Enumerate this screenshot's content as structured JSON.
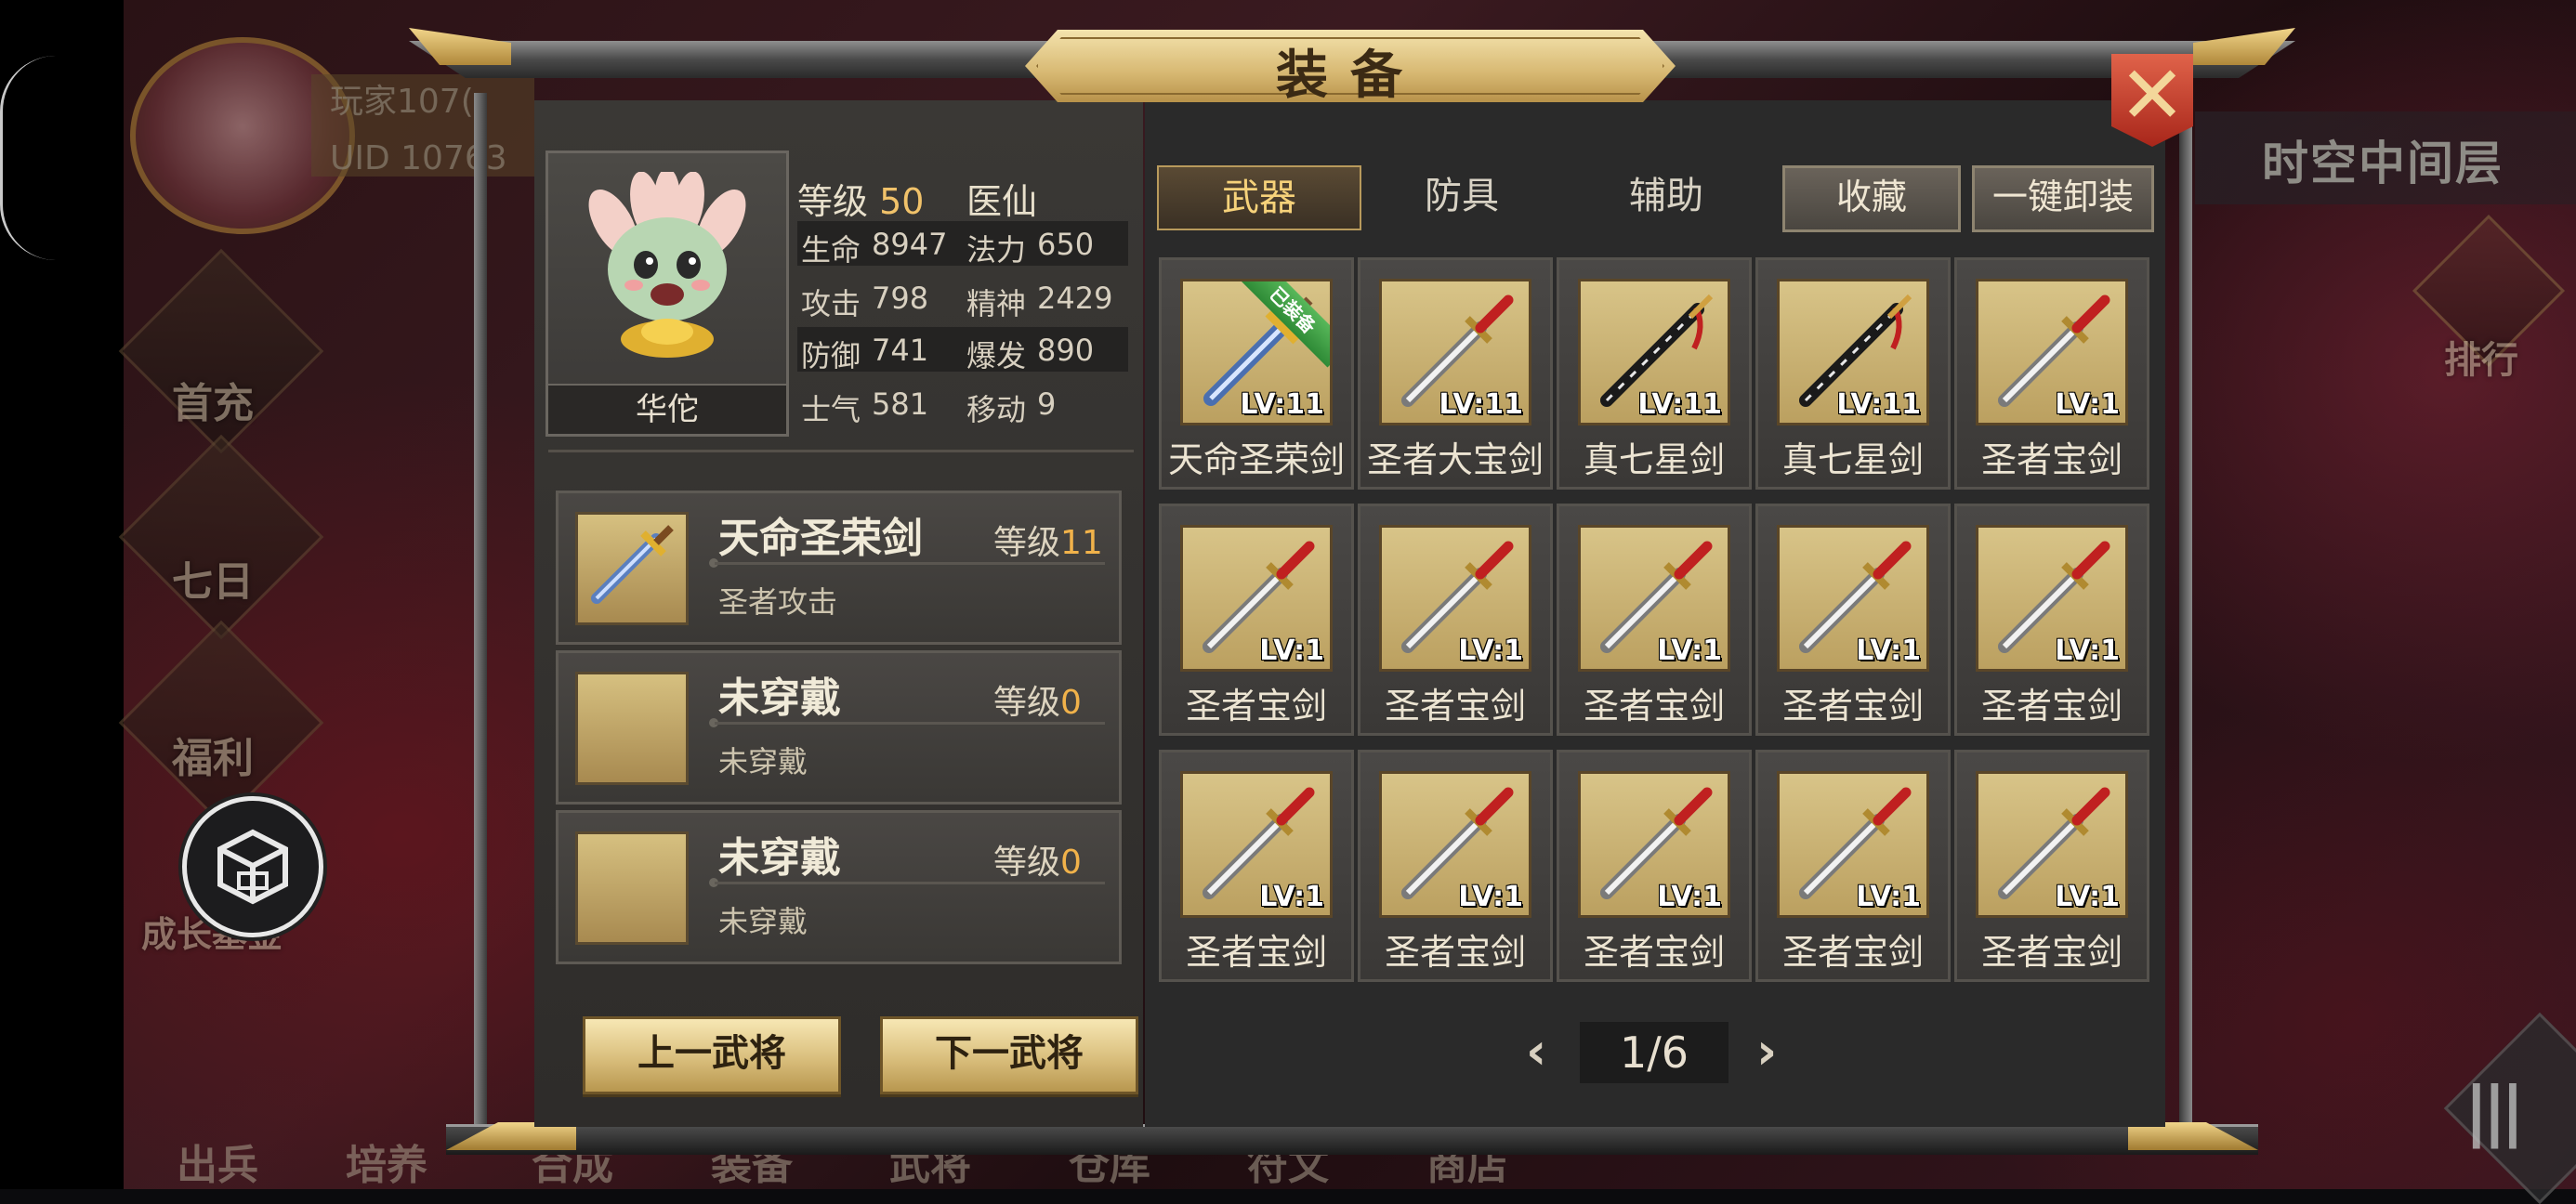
{
  "background": {
    "player_name": "玩家107(",
    "player_uid": "UID  10763",
    "left_menu": [
      "首充",
      "七日",
      "福利",
      "成长基金"
    ],
    "right_tag": "时空中间层",
    "rank_label": "排行",
    "bottom_menu": [
      "出兵",
      "培养",
      "合成",
      "装备",
      "武将",
      "仓库",
      "符文",
      "商店"
    ]
  },
  "window": {
    "title": "装备",
    "close_symbol": "✕"
  },
  "character": {
    "name": "华佗",
    "level_label": "等级",
    "level": "50",
    "class": "医仙",
    "stats": [
      {
        "label1": "生命",
        "value1": "8947",
        "label2": "法力",
        "value2": "650"
      },
      {
        "label1": "攻击",
        "value1": "798",
        "label2": "精神",
        "value2": "2429"
      },
      {
        "label1": "防御",
        "value1": "741",
        "label2": "爆发",
        "value2": "890"
      },
      {
        "label1": "士气",
        "value1": "581",
        "label2": "移动",
        "value2": "9"
      }
    ]
  },
  "equipped_slots": [
    {
      "name": "天命圣荣剑",
      "level_label": "等级",
      "level": "11",
      "sub": "圣者攻击"
    },
    {
      "name": "未穿戴",
      "level_label": "等级",
      "level": "0",
      "sub": "未穿戴"
    },
    {
      "name": "未穿戴",
      "level_label": "等级",
      "level": "0",
      "sub": "未穿戴"
    }
  ],
  "buttons": {
    "prev_general": "上一武将",
    "next_general": "下一武将"
  },
  "tabs": {
    "weapon": "武器",
    "armor": "防具",
    "accessory": "辅助",
    "favorites": "收藏",
    "unequip_all": "一键卸装"
  },
  "equipped_badge": "已装备",
  "items": [
    {
      "name": "天命圣荣剑",
      "lv": "LV:11",
      "icon": "holy-glory-sword-icon"
    },
    {
      "name": "圣者大宝剑",
      "lv": "LV:11",
      "icon": "saint-sword-icon"
    },
    {
      "name": "真七星剑",
      "lv": "LV:11",
      "icon": "seven-star-sword-icon"
    },
    {
      "name": "真七星剑",
      "lv": "LV:11",
      "icon": "seven-star-sword-icon"
    },
    {
      "name": "圣者宝剑",
      "lv": "LV:1",
      "icon": "saint-sword-icon"
    },
    {
      "name": "圣者宝剑",
      "lv": "LV:1",
      "icon": "saint-sword-icon"
    },
    {
      "name": "圣者宝剑",
      "lv": "LV:1",
      "icon": "saint-sword-icon"
    },
    {
      "name": "圣者宝剑",
      "lv": "LV:1",
      "icon": "saint-sword-icon"
    },
    {
      "name": "圣者宝剑",
      "lv": "LV:1",
      "icon": "saint-sword-icon"
    },
    {
      "name": "圣者宝剑",
      "lv": "LV:1",
      "icon": "saint-sword-icon"
    },
    {
      "name": "圣者宝剑",
      "lv": "LV:1",
      "icon": "saint-sword-icon"
    },
    {
      "name": "圣者宝剑",
      "lv": "LV:1",
      "icon": "saint-sword-icon"
    },
    {
      "name": "圣者宝剑",
      "lv": "LV:1",
      "icon": "saint-sword-icon"
    },
    {
      "name": "圣者宝剑",
      "lv": "LV:1",
      "icon": "saint-sword-icon"
    },
    {
      "name": "圣者宝剑",
      "lv": "LV:1",
      "icon": "saint-sword-icon"
    }
  ],
  "pager": {
    "prev": "‹",
    "next": "›",
    "page": "1/6"
  },
  "colors": {
    "accent_gold": "#f1c26a",
    "level_orange": "#f1b24a",
    "close_red": "#c8402c"
  }
}
